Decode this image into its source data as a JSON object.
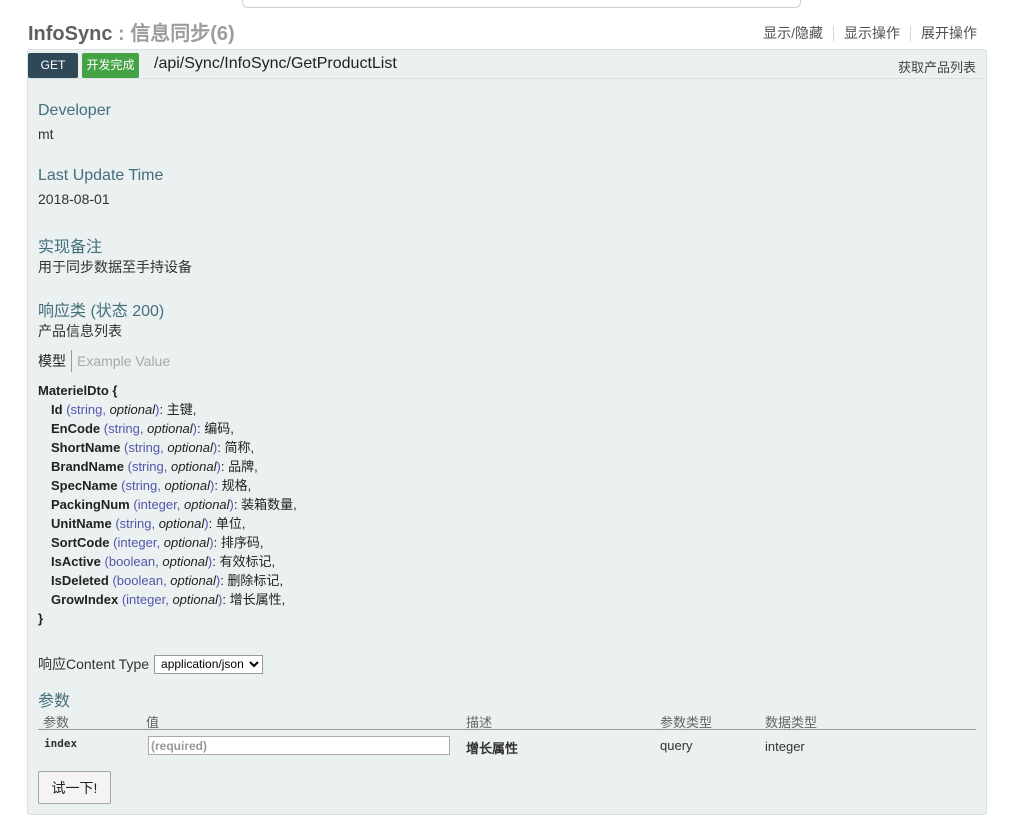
{
  "heading": {
    "resource": "InfoSync",
    "separator": " : ",
    "description": "信息同步(6)",
    "ops": [
      "显示/隐藏",
      "显示操作",
      "展开操作"
    ]
  },
  "operation": {
    "method": "GET",
    "status_badge": "开发完成",
    "path": "/api/Sync/InfoSync/GetProductList",
    "summary": "获取产品列表"
  },
  "sections": {
    "developer_label": "Developer",
    "developer_value": "mt",
    "update_label": "Last Update Time",
    "update_value": "2018-08-01",
    "notes_label": "实现备注",
    "notes_value": "用于同步数据至手持设备",
    "response_label": "响应类 (状态 200)",
    "response_value": "产品信息列表"
  },
  "model_tabs": {
    "active": "模型",
    "inactive": "Example Value"
  },
  "model": {
    "name": "MaterielDto",
    "open": " {",
    "close": "}",
    "optional": "optional",
    "props": [
      {
        "name": "Id",
        "type": "string",
        "desc": "主键"
      },
      {
        "name": "EnCode",
        "type": "string",
        "desc": "编码"
      },
      {
        "name": "ShortName",
        "type": "string",
        "desc": "简称"
      },
      {
        "name": "BrandName",
        "type": "string",
        "desc": "品牌"
      },
      {
        "name": "SpecName",
        "type": "string",
        "desc": "规格"
      },
      {
        "name": "PackingNum",
        "type": "integer",
        "desc": "装箱数量"
      },
      {
        "name": "UnitName",
        "type": "string",
        "desc": "单位"
      },
      {
        "name": "SortCode",
        "type": "integer",
        "desc": "排序码"
      },
      {
        "name": "IsActive",
        "type": "boolean",
        "desc": "有效标记"
      },
      {
        "name": "IsDeleted",
        "type": "boolean",
        "desc": "删除标记"
      },
      {
        "name": "GrowIndex",
        "type": "integer",
        "desc": "增长属性"
      }
    ]
  },
  "content_type": {
    "label": "响应Content Type",
    "selected": "application/json"
  },
  "params": {
    "title": "参数",
    "headers": [
      "参数",
      "值",
      "描述",
      "参数类型",
      "数据类型"
    ],
    "rows": [
      {
        "name": "index",
        "placeholder": "(required)",
        "desc": "增长属性",
        "param_type": "query",
        "data_type": "integer"
      }
    ]
  },
  "try_button": "试一下!"
}
